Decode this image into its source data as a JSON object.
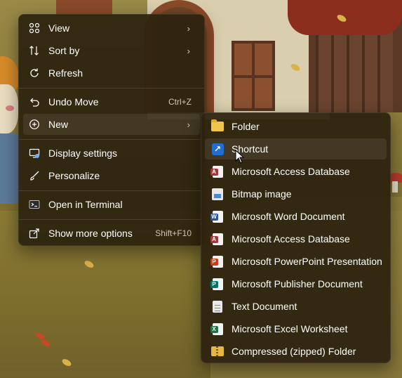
{
  "main_menu": {
    "items": [
      {
        "label": "View",
        "icon": "view-grid-icon",
        "submenu": true
      },
      {
        "label": "Sort by",
        "icon": "sort-icon",
        "submenu": true
      },
      {
        "label": "Refresh",
        "icon": "refresh-icon"
      },
      {
        "label": "Undo Move",
        "icon": "undo-icon",
        "shortcut": "Ctrl+Z"
      },
      {
        "label": "New",
        "icon": "add-circle-icon",
        "submenu": true,
        "active": true
      },
      {
        "label": "Display settings",
        "icon": "display-settings-icon"
      },
      {
        "label": "Personalize",
        "icon": "brush-icon"
      },
      {
        "label": "Open in Terminal",
        "icon": "terminal-icon"
      },
      {
        "label": "Show more options",
        "icon": "show-more-icon",
        "shortcut": "Shift+F10"
      }
    ]
  },
  "new_submenu": {
    "items": [
      {
        "label": "Folder",
        "icon": "folder-icon"
      },
      {
        "label": "Shortcut",
        "icon": "shortcut-icon",
        "hover": true
      },
      {
        "label": "Microsoft Access Database",
        "icon": "access-icon",
        "badge": "A",
        "color": "#a4373a"
      },
      {
        "label": "Bitmap image",
        "icon": "bitmap-icon"
      },
      {
        "label": "Microsoft Word Document",
        "icon": "word-icon",
        "badge": "W",
        "color": "#2b579a"
      },
      {
        "label": "Microsoft Access Database",
        "icon": "access-icon",
        "badge": "A",
        "color": "#a4373a"
      },
      {
        "label": "Microsoft PowerPoint Presentation",
        "icon": "powerpoint-icon",
        "badge": "P",
        "color": "#c43e1c"
      },
      {
        "label": "Microsoft Publisher Document",
        "icon": "publisher-icon",
        "badge": "P",
        "color": "#077568"
      },
      {
        "label": "Text Document",
        "icon": "text-document-icon"
      },
      {
        "label": "Microsoft Excel Worksheet",
        "icon": "excel-icon",
        "badge": "X",
        "color": "#217346"
      },
      {
        "label": "Compressed (zipped) Folder",
        "icon": "zip-folder-icon"
      }
    ]
  }
}
